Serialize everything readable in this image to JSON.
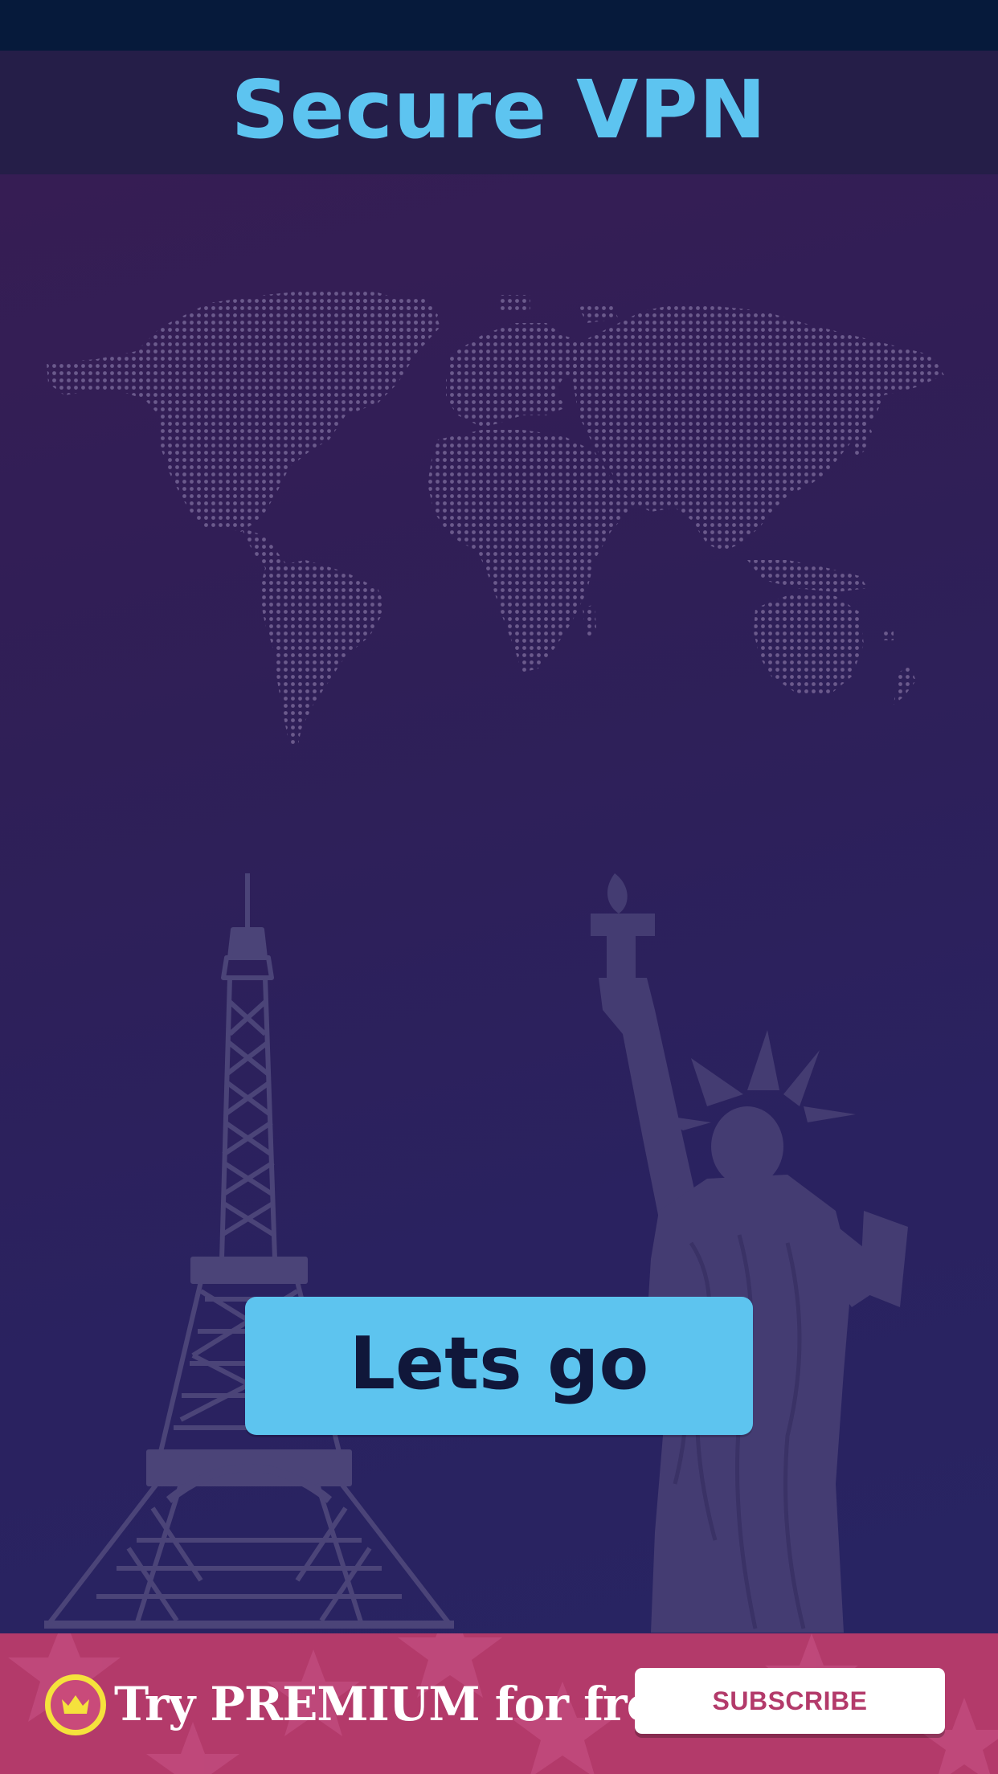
{
  "header": {
    "title": "Secure VPN"
  },
  "main": {
    "background_illustrations": [
      "world-map",
      "eiffel-tower",
      "statue-of-liberty"
    ],
    "cta_label": "Lets go"
  },
  "promo": {
    "icon": "crown-icon",
    "text": "Try PREMIUM for free",
    "subscribe_label": "SUBSCRIBE"
  },
  "colors": {
    "accent": "#5dc4f0",
    "promo": "#b33a6a",
    "crown": "#f5e23c",
    "header_bg": "#251e48",
    "status_bar": "#061a3b"
  }
}
